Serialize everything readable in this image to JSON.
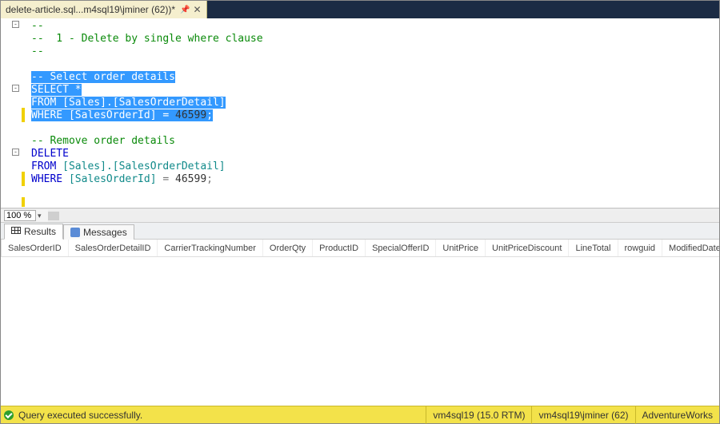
{
  "tab": {
    "title": "delete-article.sql...m4sql19\\jminer (62))*",
    "pinned": true
  },
  "editor": {
    "lines": [
      {
        "type": "comment",
        "text": "--"
      },
      {
        "type": "comment",
        "text": "--  1 - Delete by single where clause"
      },
      {
        "type": "comment",
        "text": "--"
      },
      {
        "type": "blank",
        "text": ""
      },
      {
        "type": "comment-sel",
        "text": "-- Select order details"
      },
      {
        "type": "sql-sel",
        "kw": "SELECT",
        "rest": " *"
      },
      {
        "type": "sql-sel",
        "kw": "FROM",
        "obj": " [Sales].[SalesOrderDetail]"
      },
      {
        "type": "sql-sel",
        "kw": "WHERE",
        "obj2": " [SalesOrderId]",
        "eq": " = ",
        "num": "46599",
        "semi": ";"
      },
      {
        "type": "blank",
        "text": ""
      },
      {
        "type": "comment",
        "text": "-- Remove order details"
      },
      {
        "type": "sql",
        "kw": "DELETE",
        "rest": ""
      },
      {
        "type": "sql",
        "kw": "FROM",
        "obj": " [Sales].[SalesOrderDetail]"
      },
      {
        "type": "sql",
        "kw": "WHERE",
        "obj2": " [SalesOrderId]",
        "eq": " = ",
        "num": "46599",
        "semi": ";"
      }
    ],
    "zoom": "100 %"
  },
  "results": {
    "tabs": {
      "results": "Results",
      "messages": "Messages"
    },
    "columns": [
      "SalesOrderID",
      "SalesOrderDetailID",
      "CarrierTrackingNumber",
      "OrderQty",
      "ProductID",
      "SpecialOfferID",
      "UnitPrice",
      "UnitPriceDiscount",
      "LineTotal",
      "rowguid",
      "ModifiedDate"
    ],
    "rows": []
  },
  "status": {
    "message": "Query executed successfully.",
    "server": "vm4sql19 (15.0 RTM)",
    "login": "vm4sql19\\jminer (62)",
    "database": "AdventureWorks"
  }
}
